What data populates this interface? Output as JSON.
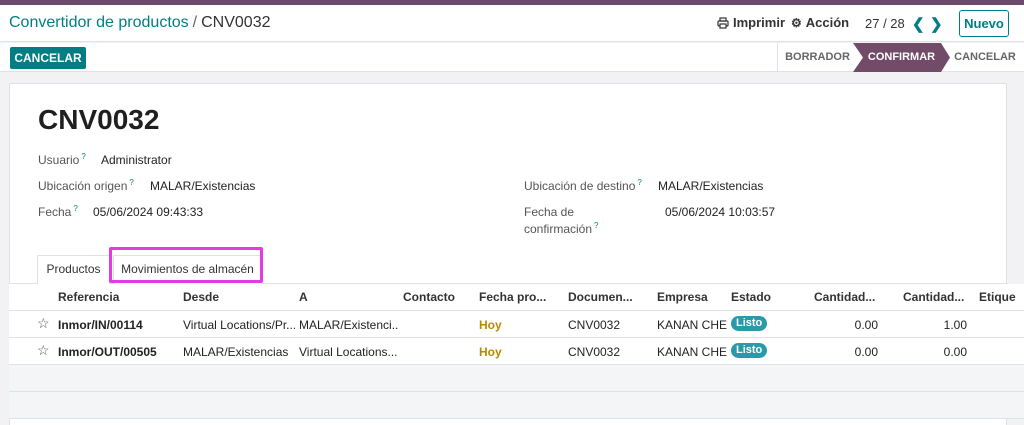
{
  "breadcrumb": {
    "parent": "Convertidor de productos",
    "separator": "/",
    "current": "CNV0032"
  },
  "actions": {
    "print_label": "Imprimir",
    "action_label": "Acción",
    "new_label": "Nuevo"
  },
  "pager": {
    "value": "27 / 28"
  },
  "statusbar": {
    "cancel_button": "CANCELAR",
    "stages": [
      {
        "label": "BORRADOR"
      },
      {
        "label": "CONFIRMAR",
        "active": true
      },
      {
        "label": "CANCELAR"
      }
    ]
  },
  "record": {
    "title": "CNV0032",
    "fields": {
      "user_label": "Usuario",
      "user_value": "Administrator",
      "origin_label": "Ubicación origen",
      "origin_value": "MALAR/Existencias",
      "dest_label": "Ubicación de destino",
      "dest_value": "MALAR/Existencias",
      "date_label": "Fecha",
      "date_value": "05/06/2024 09:43:33",
      "confirm_label_1": "Fecha de",
      "confirm_label_2": "confirmación",
      "confirm_value": "05/06/2024 10:03:57"
    }
  },
  "tabs": [
    {
      "label": "Productos"
    },
    {
      "label": "Movimientos de almacén",
      "active": true
    }
  ],
  "table": {
    "columns": [
      "Referencia",
      "Desde",
      "A",
      "Contacto",
      "Fecha pro...",
      "Documen...",
      "Empresa",
      "Estado",
      "Cantidad...",
      "Cantidad...",
      "Etique"
    ],
    "rows": [
      {
        "ref": "Inmor/IN/00114",
        "from": "Virtual Locations/Pr...",
        "to": "MALAR/Existenci...",
        "contact": "",
        "date": "Hoy",
        "doc": "CNV0032",
        "company": "KANAN CHE",
        "state": "Listo",
        "qty1": "0.00",
        "qty2": "1.00"
      },
      {
        "ref": "Inmor/OUT/00505",
        "from": "MALAR/Existencias",
        "to": "Virtual Locations...",
        "contact": "",
        "date": "Hoy",
        "doc": "CNV0032",
        "company": "KANAN CHE",
        "state": "Listo",
        "qty1": "0.00",
        "qty2": "0.00"
      }
    ]
  },
  "colors": {
    "brand": "#714b67",
    "accent": "#017e84",
    "highlight": "#e43ae0",
    "today": "#b78a00",
    "badge": "#2a9aaa"
  },
  "icons": {
    "print": "printer-icon",
    "action": "gear-icon",
    "prev": "chevron-left-icon",
    "next": "chevron-right-icon",
    "favorite": "star-icon",
    "help": "question-mark-icon"
  }
}
